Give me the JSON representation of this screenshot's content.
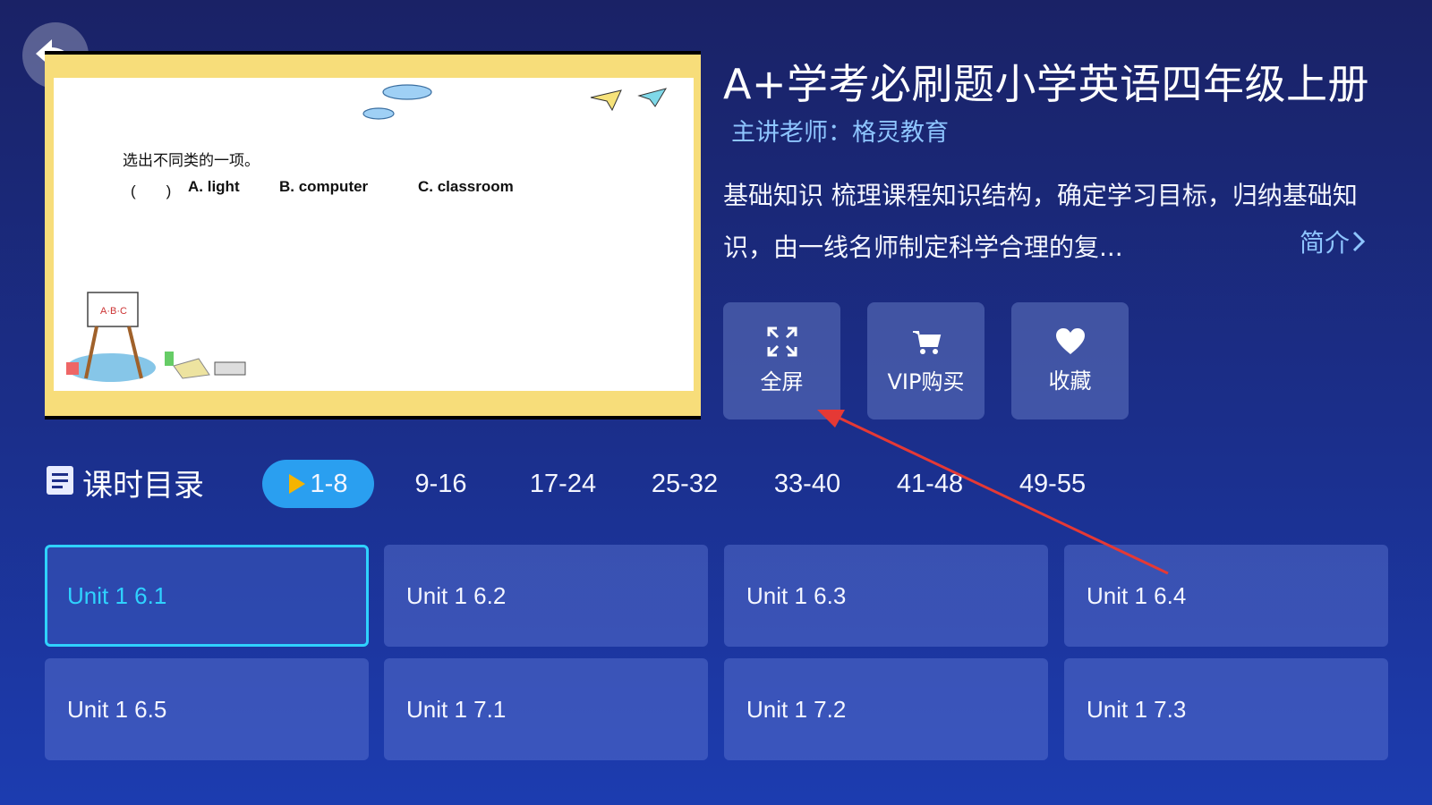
{
  "course": {
    "title": "A+学考必刷题小学英语四年级上册",
    "teacher": "主讲老师：格灵教育",
    "description": "基础知识 梳理课程知识结构，确定学习目标，归纳基础知识，由一线名师制定科学合理的复...",
    "intro_link": "简介"
  },
  "preview": {
    "question": "选出不同类的一项。",
    "paren": "(　　)",
    "option_a": "A. light",
    "option_b": "B. computer",
    "option_c": "C. classroom"
  },
  "actions": [
    {
      "label": "全屏",
      "icon": "fullscreen-icon"
    },
    {
      "label": "VIP购买",
      "icon": "cart-icon"
    },
    {
      "label": "收藏",
      "icon": "heart-icon"
    }
  ],
  "catalog": {
    "title": "课时目录",
    "tabs": [
      "1-8",
      "9-16",
      "17-24",
      "25-32",
      "33-40",
      "41-48",
      "49-55"
    ],
    "active_tab": "1-8",
    "lessons": [
      "Unit 1 6.1",
      "Unit 1 6.2",
      "Unit 1 6.3",
      "Unit 1 6.4",
      "Unit 1 6.5",
      "Unit 1 7.1",
      "Unit 1 7.2",
      "Unit 1 7.3"
    ],
    "selected_lesson": "Unit 1 6.1"
  },
  "colors": {
    "accent": "#2a9ff0",
    "selected_border": "#2fd2ff",
    "link": "#8ec5ff",
    "annotation_arrow": "#e53935"
  }
}
